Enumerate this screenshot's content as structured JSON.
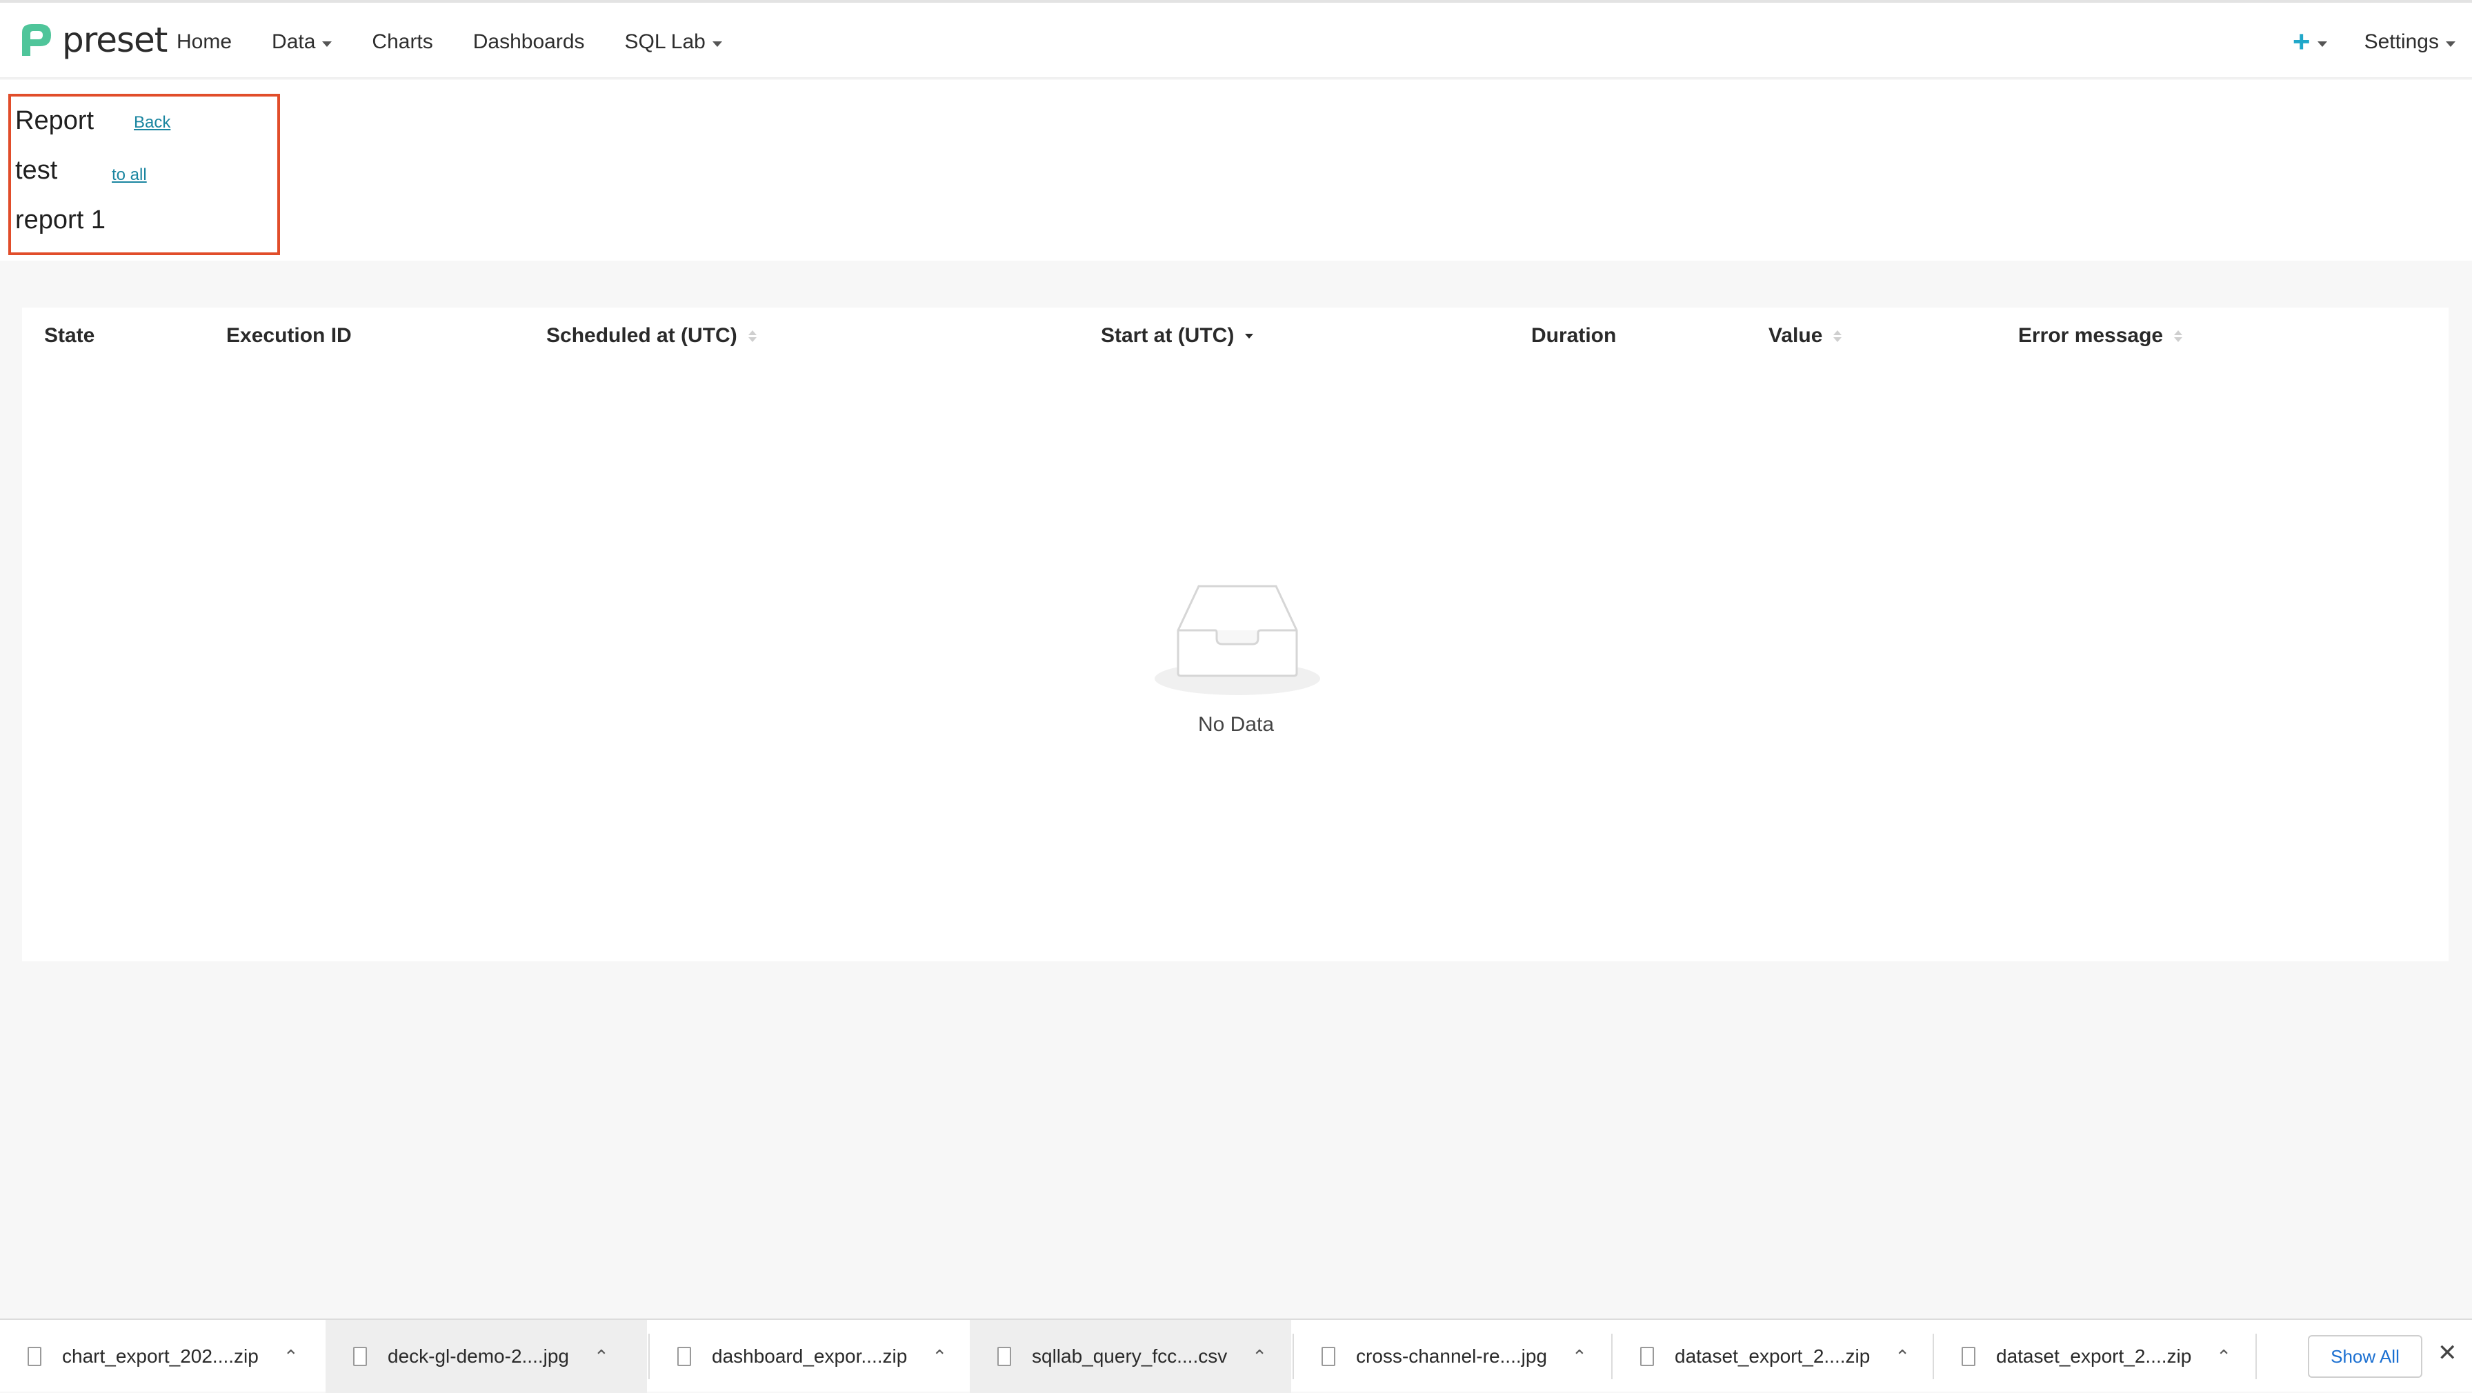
{
  "nav": {
    "logo_text": "preset",
    "items": [
      {
        "label": "Home",
        "dropdown": false
      },
      {
        "label": "Data",
        "dropdown": true
      },
      {
        "label": "Charts",
        "dropdown": false
      },
      {
        "label": "Dashboards",
        "dropdown": false
      },
      {
        "label": "SQL Lab",
        "dropdown": true
      }
    ],
    "plus_label": "+",
    "settings_label": "Settings"
  },
  "header": {
    "title_lines": [
      "Report",
      "test",
      "report 1"
    ],
    "back_link_lines": [
      "Back",
      "to all"
    ]
  },
  "table": {
    "columns": [
      {
        "label": "State",
        "sortable": false
      },
      {
        "label": "Execution ID",
        "sortable": false
      },
      {
        "label": "Scheduled at (UTC)",
        "sortable": true
      },
      {
        "label": "Start at (UTC)",
        "sortable": true,
        "sorted": "desc"
      },
      {
        "label": "Duration",
        "sortable": false
      },
      {
        "label": "Value",
        "sortable": true
      },
      {
        "label": "Error message",
        "sortable": true
      }
    ],
    "rows": [],
    "empty_text": "No Data"
  },
  "downloads": {
    "items": [
      {
        "name": "chart_export_202....zip",
        "highlighted": false
      },
      {
        "name": "deck-gl-demo-2....jpg",
        "highlighted": true
      },
      {
        "name": "dashboard_expor....zip",
        "highlighted": false
      },
      {
        "name": "sqllab_query_fcc....csv",
        "highlighted": true
      },
      {
        "name": "cross-channel-re....jpg",
        "highlighted": false
      },
      {
        "name": "dataset_export_2....zip",
        "highlighted": false
      },
      {
        "name": "dataset_export_2....zip",
        "highlighted": false
      }
    ],
    "show_all_label": "Show All",
    "close_label": "✕"
  },
  "colors": {
    "accent": "#20a7c9",
    "link": "#1a85a0",
    "highlight_border": "#e14d2a",
    "logo_green": "#4fc59a"
  }
}
